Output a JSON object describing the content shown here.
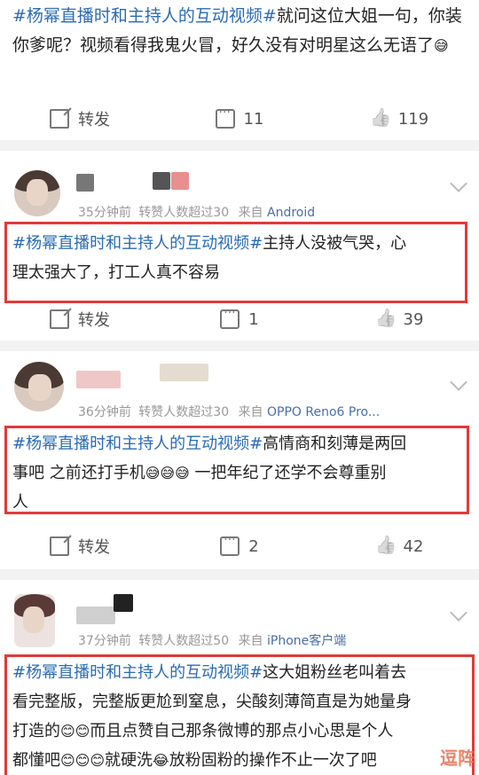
{
  "post": {
    "tag": "#杨幂直播时和主持人的互动视频#",
    "text_after_tag": "就问这位大姐一句，你装你爹呢？视频看得我鬼火冒，好久没有对明星这么无语了",
    "emoji": "😅",
    "share_label": "转发",
    "comment_count": "11",
    "like_count": "119"
  },
  "comments": [
    {
      "meta_time": "35分钟前",
      "meta_repost": "转赞人数超过30",
      "meta_source_prefix": "来自",
      "meta_source": "Android",
      "tag": "#杨幂直播时和主持人的互动视频#",
      "line1": "主持人没被气哭，心",
      "line2": "理太强大了，打工人真不容易",
      "share_label": "转发",
      "comment_count": "1",
      "like_count": "39"
    },
    {
      "meta_time": "36分钟前",
      "meta_repost": "转赞人数超过30",
      "meta_source_prefix": "来自",
      "meta_source": "OPPO Reno6 Pro...",
      "tag": "#杨幂直播时和主持人的互动视频#",
      "line1": "高情商和刻薄是两回",
      "line2a": "事吧 之前还打手机",
      "emoji": "😅😅😅",
      "line2b": " 一把年纪了还学不会尊重别",
      "line3": "人",
      "share_label": "转发",
      "comment_count": "2",
      "like_count": "42"
    },
    {
      "meta_time": "37分钟前",
      "meta_repost": "转赞人数超过50",
      "meta_source_prefix": "来自",
      "meta_source": "iPhone客户端",
      "tag": "#杨幂直播时和主持人的互动视频#",
      "line1": "这大姐粉丝老叫着去",
      "line2": "看完整版，完整版更尬到窒息，尖酸刻薄简直是为她量身",
      "line3a": "打造的",
      "emoji1": "😊😊",
      "line3b": "而且点赞自己那条微博的那点小心思是个人",
      "line4a": "都懂吧",
      "emoji2": "😊😊😊",
      "line4b": "就硬洗",
      "emoji3": "😂",
      "line4c": "放粉固粉的操作不止一次了吧"
    }
  ],
  "watermark": "逗阵"
}
